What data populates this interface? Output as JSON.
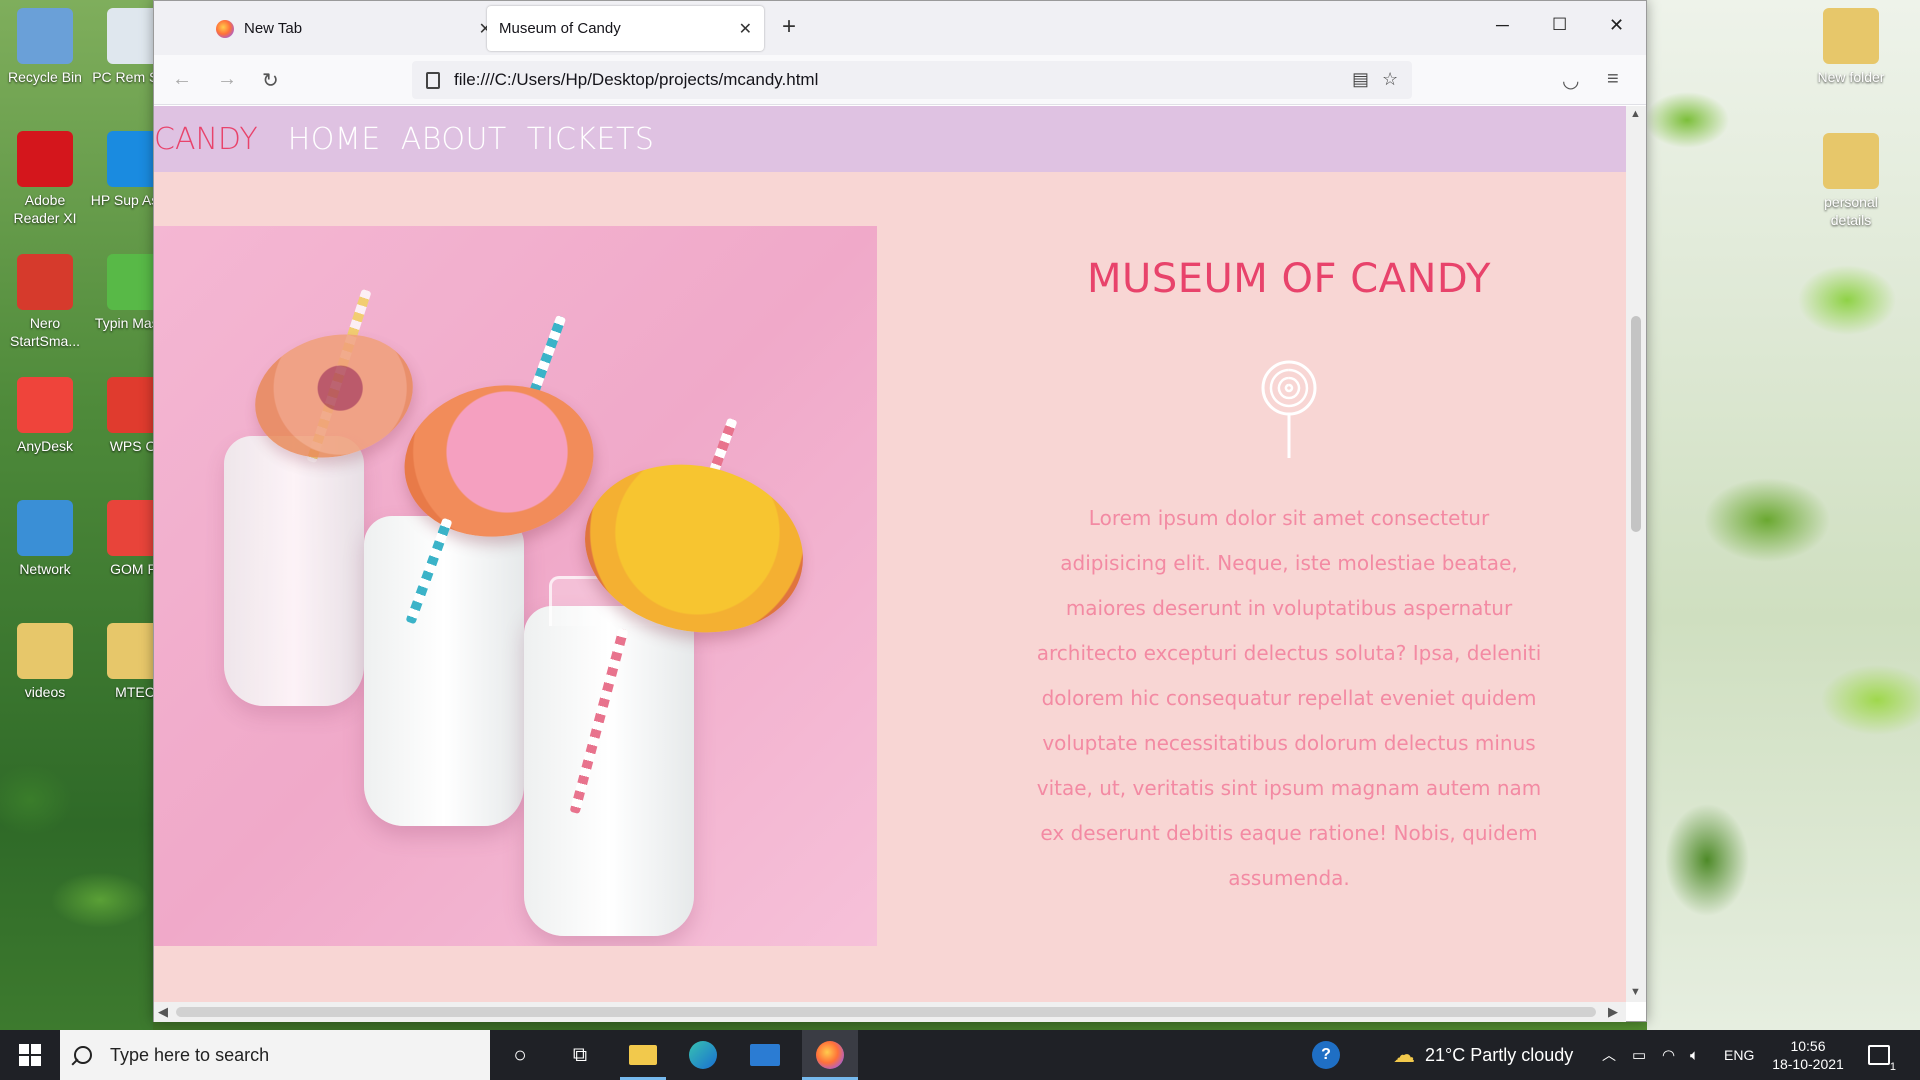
{
  "desktop": {
    "left_icons": [
      {
        "label": "Recycle Bin",
        "icon": "recycle-bin-icon",
        "color": "#6aa0d8"
      },
      {
        "label": "Adobe Reader XI",
        "icon": "adobe-reader-icon",
        "color": "#d4161c"
      },
      {
        "label": "Nero StartSma...",
        "icon": "nero-icon",
        "color": "#d63a2c"
      },
      {
        "label": "AnyDesk",
        "icon": "anydesk-icon",
        "color": "#ef443b"
      },
      {
        "label": "Network",
        "icon": "network-icon",
        "color": "#3a8fd6"
      },
      {
        "label": "videos",
        "icon": "folder-icon",
        "color": "#e7c76a"
      }
    ],
    "left_icons_col2": [
      {
        "label": "PC Rem Serv",
        "icon": "pc-remote-icon",
        "color": "#dfe7ee"
      },
      {
        "label": "HP Sup Assist",
        "icon": "hp-support-icon",
        "color": "#1a8be0"
      },
      {
        "label": "Typin Master",
        "icon": "typing-master-icon",
        "color": "#58b947"
      },
      {
        "label": "WPS Of",
        "icon": "wps-office-icon",
        "color": "#e03b2e"
      },
      {
        "label": "GOM Pl",
        "icon": "gom-player-icon",
        "color": "#e8443a"
      },
      {
        "label": "MTEC",
        "icon": "folder-icon",
        "color": "#e7c76a"
      }
    ],
    "right_icons": [
      {
        "label": "New folder",
        "icon": "folder-icon"
      },
      {
        "label": "personal details",
        "icon": "folder-icon"
      }
    ]
  },
  "browser": {
    "tabs": [
      {
        "label": "New Tab",
        "active": false
      },
      {
        "label": "Museum of Candy",
        "active": true
      }
    ],
    "new_tab_symbol": "+",
    "url": "file:///C:/Users/Hp/Desktop/projects/mcandy.html"
  },
  "site": {
    "brand": "CANDY",
    "nav": [
      "HOME",
      "ABOUT",
      "TICKETS"
    ],
    "title": "MUSEUM OF CANDY",
    "body": "Lorem ipsum dolor sit amet consectetur adipisicing elit. Neque, iste molestiae beatae, maiores deserunt in voluptatibus aspernatur architecto excepturi delectus soluta? Ipsa, deleniti dolorem hic consequatur repellat eveniet quidem voluptate necessitatibus dolorum delectus minus vitae, ut, veritatis sint ipsum magnam autem nam ex deserunt debitis eaque ratione! Nobis, quidem assumenda.",
    "colors": {
      "accent": "#e8436b",
      "nav_bg": "#dfc2e2",
      "page_bg": "#f8d6d4",
      "text": "#f38aa3"
    }
  },
  "taskbar": {
    "search_placeholder": "Type here to search",
    "weather": "21°C  Partly cloudy",
    "language": "ENG",
    "time": "10:56",
    "date": "18-10-2021",
    "notification_count": "1"
  }
}
